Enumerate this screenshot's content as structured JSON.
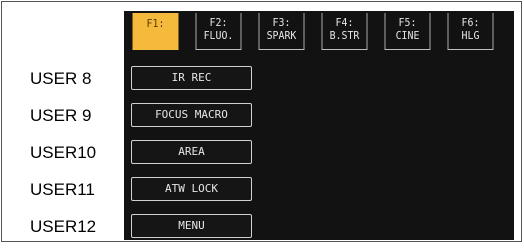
{
  "function_keys": [
    {
      "line1": "F1:",
      "line2": "",
      "active": true
    },
    {
      "line1": "F2:",
      "line2": "FLUO.",
      "active": false
    },
    {
      "line1": "F3:",
      "line2": "SPARK",
      "active": false
    },
    {
      "line1": "F4:",
      "line2": "B.STR",
      "active": false
    },
    {
      "line1": "F5:",
      "line2": "CINE",
      "active": false
    },
    {
      "line1": "F6:",
      "line2": "HLG",
      "active": false
    }
  ],
  "user_buttons": [
    {
      "label": "USER 8",
      "button": "IR REC"
    },
    {
      "label": "USER 9",
      "button": "FOCUS MACRO"
    },
    {
      "label": "USER10",
      "button": "AREA"
    },
    {
      "label": "USER11",
      "button": "ATW LOCK"
    },
    {
      "label": "USER12",
      "button": "MENU"
    }
  ],
  "colors": {
    "active_key": "#f5b93c",
    "screen_background": "#121212",
    "screen_text": "#e6e6e6"
  }
}
